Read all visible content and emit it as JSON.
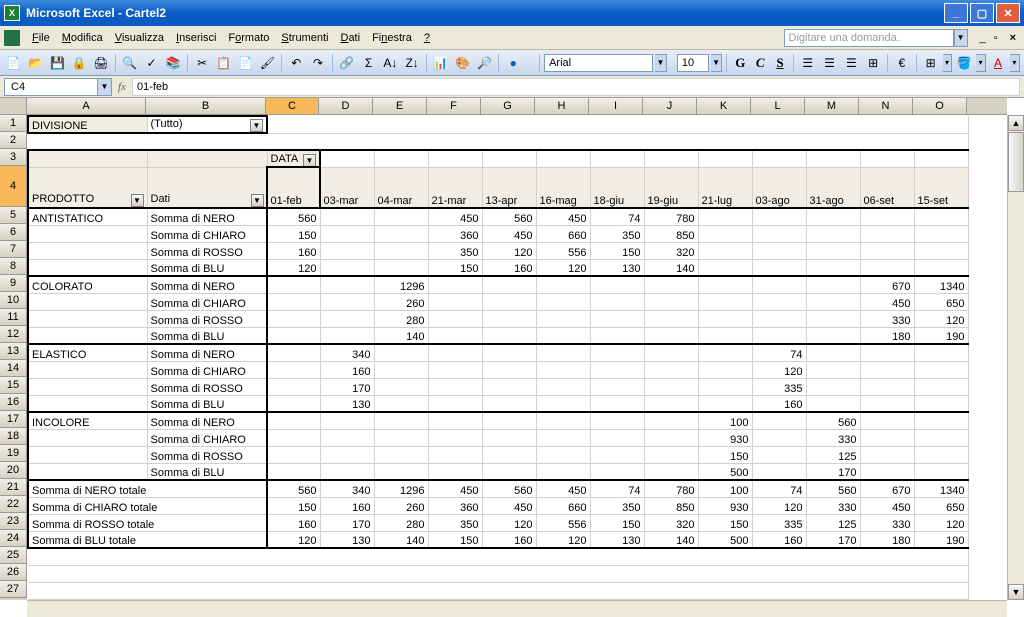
{
  "app": {
    "title": "Microsoft Excel - Cartel2"
  },
  "menubar": {
    "items": [
      "File",
      "Modifica",
      "Visualizza",
      "Inserisci",
      "Formato",
      "Strumenti",
      "Dati",
      "Finestra",
      "?"
    ],
    "help_placeholder": "Digitare una domanda."
  },
  "toolbar": {
    "font": "Arial",
    "size": "10"
  },
  "formula": {
    "cell_ref": "C4",
    "value": "01-feb"
  },
  "columns": {
    "letters": [
      "A",
      "B",
      "C",
      "D",
      "E",
      "F",
      "G",
      "H",
      "I",
      "J",
      "K",
      "L",
      "M",
      "N",
      "O"
    ],
    "widths": [
      119,
      120,
      53,
      54,
      54,
      54,
      54,
      54,
      54,
      54,
      54,
      54,
      54,
      54,
      54
    ]
  },
  "rows": [
    1,
    2,
    3,
    4,
    5,
    6,
    7,
    8,
    9,
    10,
    11,
    12,
    13,
    14,
    15,
    16,
    17,
    18,
    19,
    20,
    21,
    22,
    23,
    24,
    25,
    26,
    27
  ],
  "pivot": {
    "filter_label": "DIVISIONE",
    "filter_value": "(Tutto)",
    "col_field": "DATA",
    "row_field": "PRODOTTO",
    "data_field": "Dati",
    "dates": [
      "01-feb",
      "03-mar",
      "04-mar",
      "21-mar",
      "13-apr",
      "16-mag",
      "18-giu",
      "19-giu",
      "21-lug",
      "03-ago",
      "31-ago",
      "06-set",
      "15-set"
    ],
    "products": [
      {
        "name": "ANTISTATICO",
        "series": [
          {
            "label": "Somma di NERO",
            "v": [
              "560",
              "",
              "",
              "450",
              "560",
              "450",
              "74",
              "780",
              "",
              "",
              "",
              "",
              ""
            ]
          },
          {
            "label": "Somma di CHIARO",
            "v": [
              "150",
              "",
              "",
              "360",
              "450",
              "660",
              "350",
              "850",
              "",
              "",
              "",
              "",
              ""
            ]
          },
          {
            "label": "Somma di ROSSO",
            "v": [
              "160",
              "",
              "",
              "350",
              "120",
              "556",
              "150",
              "320",
              "",
              "",
              "",
              "",
              ""
            ]
          },
          {
            "label": "Somma di BLU",
            "v": [
              "120",
              "",
              "",
              "150",
              "160",
              "120",
              "130",
              "140",
              "",
              "",
              "",
              "",
              ""
            ]
          }
        ]
      },
      {
        "name": "COLORATO",
        "series": [
          {
            "label": "Somma di NERO",
            "v": [
              "",
              "",
              "1296",
              "",
              "",
              "",
              "",
              "",
              "",
              "",
              "",
              "670",
              "1340"
            ]
          },
          {
            "label": "Somma di CHIARO",
            "v": [
              "",
              "",
              "260",
              "",
              "",
              "",
              "",
              "",
              "",
              "",
              "",
              "450",
              "650"
            ]
          },
          {
            "label": "Somma di ROSSO",
            "v": [
              "",
              "",
              "280",
              "",
              "",
              "",
              "",
              "",
              "",
              "",
              "",
              "330",
              "120"
            ]
          },
          {
            "label": "Somma di BLU",
            "v": [
              "",
              "",
              "140",
              "",
              "",
              "",
              "",
              "",
              "",
              "",
              "",
              "180",
              "190"
            ]
          }
        ]
      },
      {
        "name": "ELASTICO",
        "series": [
          {
            "label": "Somma di NERO",
            "v": [
              "",
              "340",
              "",
              "",
              "",
              "",
              "",
              "",
              "",
              "74",
              "",
              "",
              ""
            ]
          },
          {
            "label": "Somma di CHIARO",
            "v": [
              "",
              "160",
              "",
              "",
              "",
              "",
              "",
              "",
              "",
              "120",
              "",
              "",
              ""
            ]
          },
          {
            "label": "Somma di ROSSO",
            "v": [
              "",
              "170",
              "",
              "",
              "",
              "",
              "",
              "",
              "",
              "335",
              "",
              "",
              ""
            ]
          },
          {
            "label": "Somma di BLU",
            "v": [
              "",
              "130",
              "",
              "",
              "",
              "",
              "",
              "",
              "",
              "160",
              "",
              "",
              ""
            ]
          }
        ]
      },
      {
        "name": "INCOLORE",
        "series": [
          {
            "label": "Somma di NERO",
            "v": [
              "",
              "",
              "",
              "",
              "",
              "",
              "",
              "",
              "100",
              "",
              "560",
              "",
              ""
            ]
          },
          {
            "label": "Somma di CHIARO",
            "v": [
              "",
              "",
              "",
              "",
              "",
              "",
              "",
              "",
              "930",
              "",
              "330",
              "",
              ""
            ]
          },
          {
            "label": "Somma di ROSSO",
            "v": [
              "",
              "",
              "",
              "",
              "",
              "",
              "",
              "",
              "150",
              "",
              "125",
              "",
              ""
            ]
          },
          {
            "label": "Somma di BLU",
            "v": [
              "",
              "",
              "",
              "",
              "",
              "",
              "",
              "",
              "500",
              "",
              "170",
              "",
              ""
            ]
          }
        ]
      }
    ],
    "totals": [
      {
        "label": "Somma di NERO totale",
        "v": [
          "560",
          "340",
          "1296",
          "450",
          "560",
          "450",
          "74",
          "780",
          "100",
          "74",
          "560",
          "670",
          "1340"
        ]
      },
      {
        "label": "Somma di CHIARO totale",
        "v": [
          "150",
          "160",
          "260",
          "360",
          "450",
          "660",
          "350",
          "850",
          "930",
          "120",
          "330",
          "450",
          "650"
        ]
      },
      {
        "label": "Somma di ROSSO totale",
        "v": [
          "160",
          "170",
          "280",
          "350",
          "120",
          "556",
          "150",
          "320",
          "150",
          "335",
          "125",
          "330",
          "120"
        ]
      },
      {
        "label": "Somma di BLU totale",
        "v": [
          "120",
          "130",
          "140",
          "150",
          "160",
          "120",
          "130",
          "140",
          "500",
          "160",
          "170",
          "180",
          "190"
        ]
      }
    ]
  }
}
